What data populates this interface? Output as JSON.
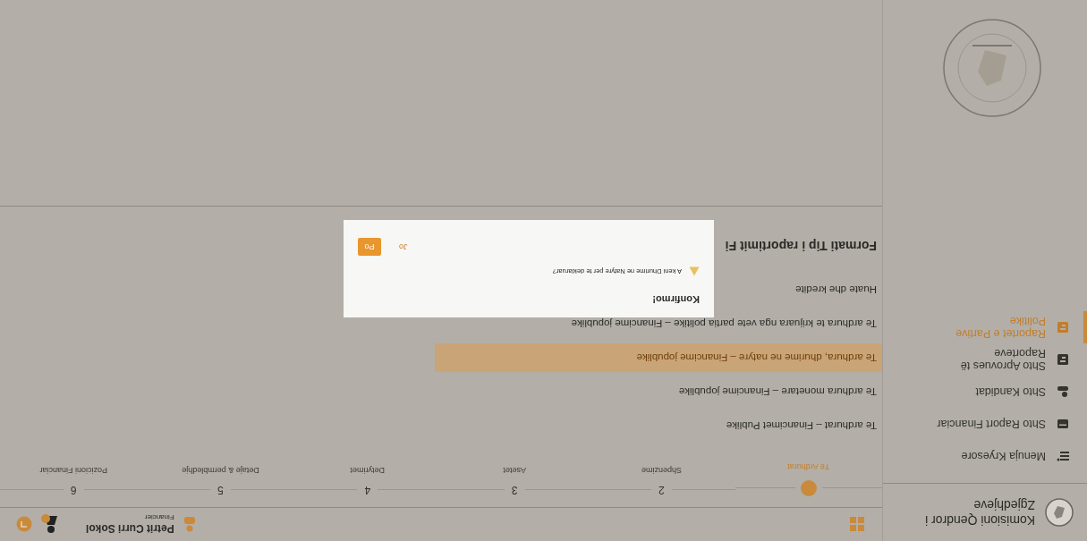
{
  "sidebar": {
    "title_lines": [
      "Komisioni Qendror i",
      "Zgjedhjeve"
    ],
    "items": [
      {
        "label": "Menuja Kryesore",
        "kind": "list",
        "selected": false
      },
      {
        "label": "Shto Raport Financiar",
        "kind": "card",
        "selected": false
      },
      {
        "label": "Shto Kandidat",
        "kind": "person",
        "selected": false
      },
      {
        "label": "Shto Aprovues të Raporteve",
        "kind": "doc",
        "selected": false
      },
      {
        "label": "Raportet e Partive Politike",
        "kind": "doc",
        "selected": true
      }
    ]
  },
  "user": {
    "name": "Petrit Curri Sokol",
    "role": "Financier"
  },
  "steps": [
    {
      "label": "Të Ardhurat",
      "selected": true
    },
    {
      "number": "2",
      "label": "Shpenzime",
      "selected": false
    },
    {
      "number": "3",
      "label": "Asetet",
      "selected": false
    },
    {
      "number": "4",
      "label": "Detyrimet",
      "selected": false
    },
    {
      "number": "5",
      "label": "Detaje & permbledhje",
      "selected": false
    },
    {
      "number": "6",
      "label": "Pozicioni Financiar",
      "selected": false
    }
  ],
  "entries": [
    {
      "label": "Te ardhurat – Financimet Publike",
      "selected": false
    },
    {
      "label": "Te ardhura monetare – Financime jopublike",
      "selected": false
    },
    {
      "label": "Te ardhura, dhurime ne natyre – Financime jopublike",
      "selected": true
    },
    {
      "label": "Te ardhura te krijuara nga vete partia politike – Financime jopublike",
      "selected": false
    },
    {
      "label": "Huate dhe kredite",
      "selected": false
    }
  ],
  "section_title": "Formati Tip i raportimit Fi",
  "dialog": {
    "title": "Konfirmo!",
    "message": "A keni Dhurime ne Natyre per te deklaruar?",
    "buttons": [
      {
        "label": "Po",
        "primary": true
      },
      {
        "label": "Jo",
        "primary": false
      }
    ]
  }
}
